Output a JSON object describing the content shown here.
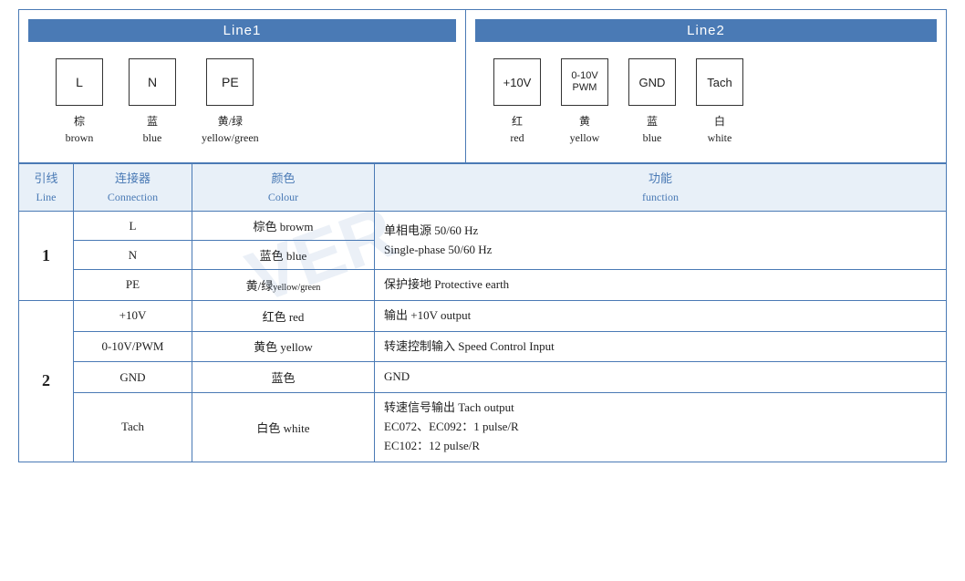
{
  "line1": {
    "title": "Line1",
    "connectors": [
      {
        "id": "L",
        "label": "L",
        "zh": "棕",
        "en": "brown"
      },
      {
        "id": "N",
        "label": "N",
        "zh": "蓝",
        "en": "blue"
      },
      {
        "id": "PE",
        "label": "PE",
        "zh": "黄/绿",
        "en": "yellow/green"
      }
    ]
  },
  "line2": {
    "title": "Line2",
    "connectors": [
      {
        "id": "+10V",
        "label": "+10V",
        "zh": "红",
        "en": "red"
      },
      {
        "id": "0-10V/PWM",
        "label": "0-10V\nPWM",
        "zh": "黄",
        "en": "yellow"
      },
      {
        "id": "GND",
        "label": "GND",
        "zh": "蓝",
        "en": "blue"
      },
      {
        "id": "Tach",
        "label": "Tach",
        "zh": "白",
        "en": "white"
      }
    ]
  },
  "table": {
    "headers": {
      "line_zh": "引线",
      "line_en": "Line",
      "conn_zh": "连接器",
      "conn_en": "Connection",
      "color_zh": "颜色",
      "color_en": "Colour",
      "func_zh": "功能",
      "func_en": "function"
    },
    "rows": [
      {
        "line": "1",
        "rowspan": 3,
        "entries": [
          {
            "connector": "L",
            "color": "棕色 browm",
            "function": "单相电源 50/60 Hz\nSingle-phase 50/60 Hz"
          },
          {
            "connector": "N",
            "color": "蓝色 blue",
            "function": ""
          },
          {
            "connector": "PE",
            "color": "黄/绿 yellow/green",
            "color_sub": true,
            "function": "保护接地 Protective earth"
          }
        ]
      },
      {
        "line": "2",
        "rowspan": 4,
        "entries": [
          {
            "connector": "+10V",
            "color": "红色 red",
            "function": "输出 +10V output"
          },
          {
            "connector": "0-10V/PWM",
            "color": "黄色 yellow",
            "function": "转速控制输入 Speed Control Input"
          },
          {
            "connector": "GND",
            "color": "蓝色",
            "function": "GND"
          },
          {
            "connector": "Tach",
            "color": "白色 white",
            "function": "转速信号输出 Tach output\nEC072、EC092：1 pulse/R\nEC102：12 pulse/R"
          }
        ]
      }
    ]
  }
}
